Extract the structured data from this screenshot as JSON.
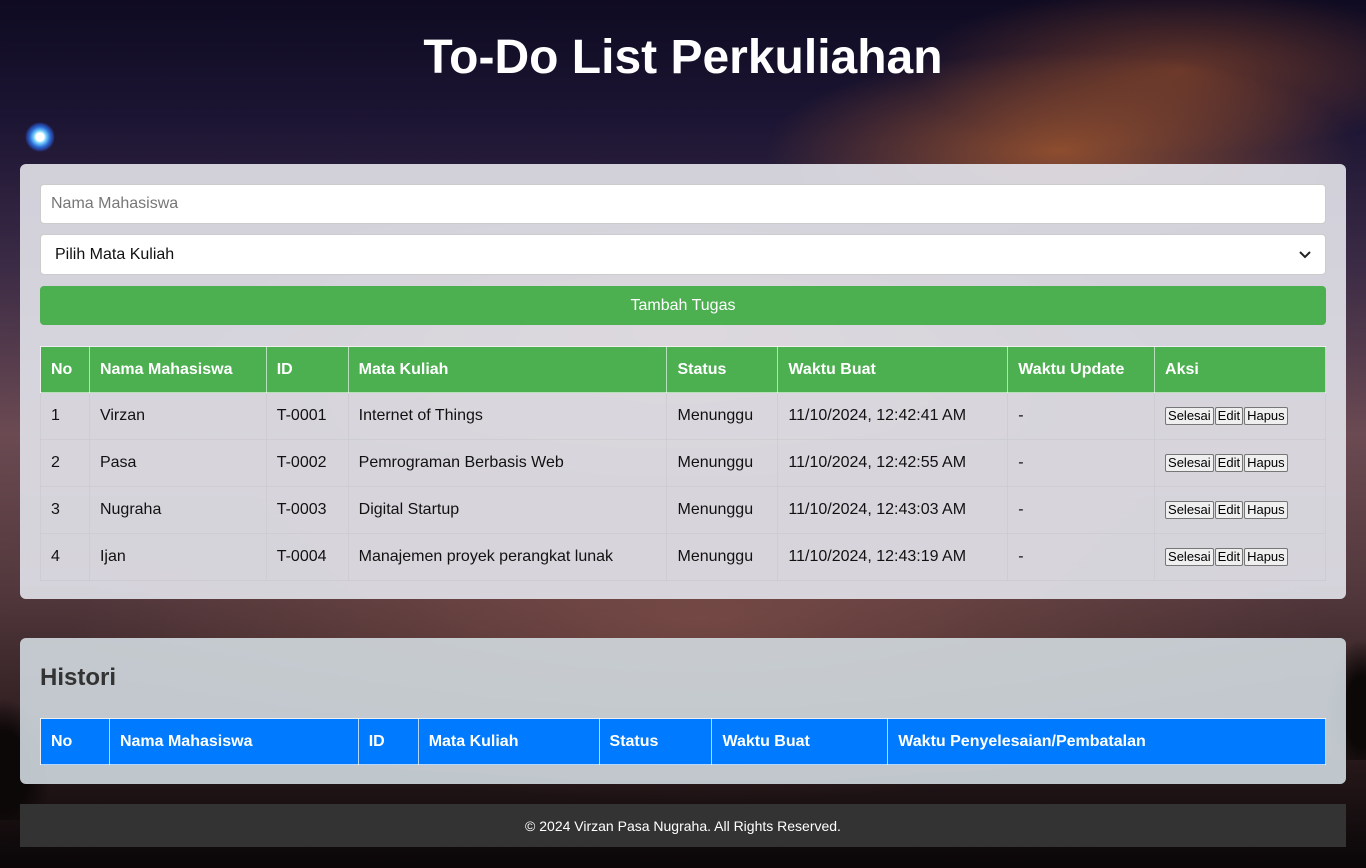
{
  "title": "To-Do List Perkuliahan",
  "form": {
    "name_placeholder": "Nama Mahasiswa",
    "course_select_value": "Pilih Mata Kuliah",
    "add_button": "Tambah Tugas"
  },
  "task_table": {
    "headers": [
      "No",
      "Nama Mahasiswa",
      "ID",
      "Mata Kuliah",
      "Status",
      "Waktu Buat",
      "Waktu Update",
      "Aksi"
    ],
    "rows": [
      {
        "no": "1",
        "name": "Virzan",
        "id": "T-0001",
        "course": "Internet of Things",
        "status": "Menunggu",
        "created": "11/10/2024, 12:42:41 AM",
        "updated": "-"
      },
      {
        "no": "2",
        "name": "Pasa",
        "id": "T-0002",
        "course": "Pemrograman Berbasis Web",
        "status": "Menunggu",
        "created": "11/10/2024, 12:42:55 AM",
        "updated": "-"
      },
      {
        "no": "3",
        "name": "Nugraha",
        "id": "T-0003",
        "course": "Digital Startup",
        "status": "Menunggu",
        "created": "11/10/2024, 12:43:03 AM",
        "updated": "-"
      },
      {
        "no": "4",
        "name": "Ijan",
        "id": "T-0004",
        "course": "Manajemen proyek perangkat lunak",
        "status": "Menunggu",
        "created": "11/10/2024, 12:43:19 AM",
        "updated": "-"
      }
    ],
    "actions": {
      "done": "Selesai",
      "edit": "Edit",
      "delete": "Hapus"
    }
  },
  "history": {
    "title": "Histori",
    "headers": [
      "No",
      "Nama Mahasiswa",
      "ID",
      "Mata Kuliah",
      "Status",
      "Waktu Buat",
      "Waktu Penyelesaian/Pembatalan"
    ]
  },
  "footer": "© 2024 Virzan Pasa Nugraha. All Rights Reserved.",
  "colors": {
    "accent_green": "#4caf50",
    "history_blue": "#007bff",
    "footer_bg": "#333333"
  },
  "icons": {
    "decoration": "glowing-orb-icon",
    "select": "chevron-down-icon"
  }
}
